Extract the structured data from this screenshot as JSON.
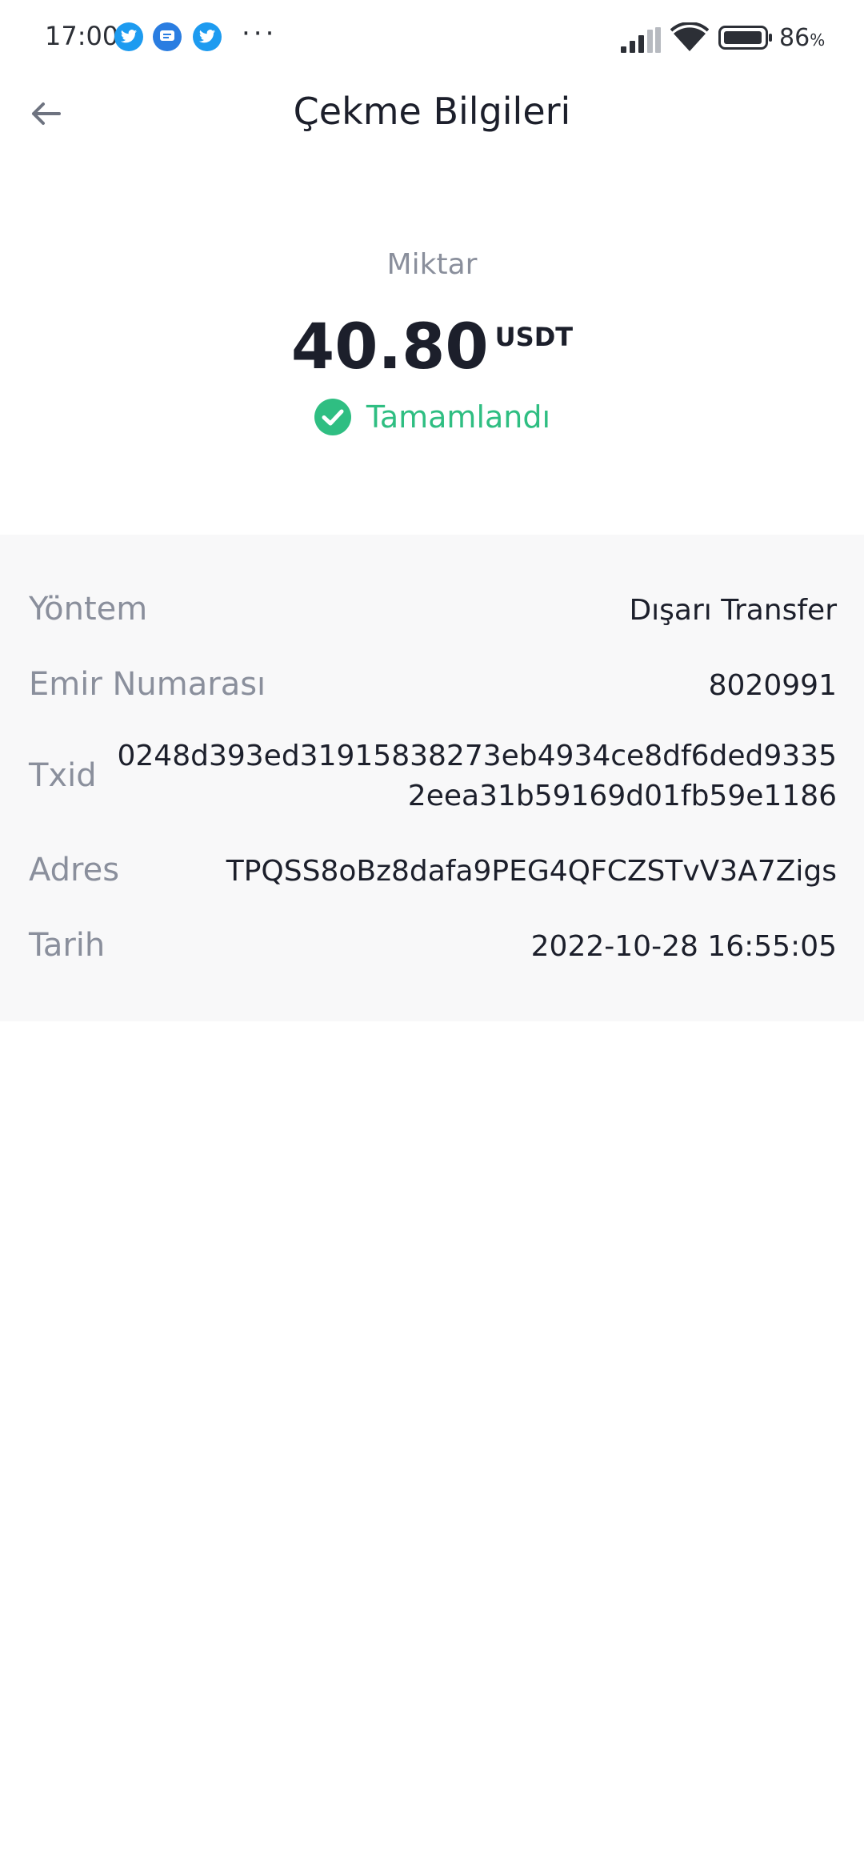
{
  "status_bar": {
    "time": "17:00",
    "notification_icons": [
      "twitter-icon",
      "messages-icon",
      "twitter-icon"
    ],
    "more": "···",
    "battery_percent": "86",
    "battery_unit": "%"
  },
  "header": {
    "title": "Çekme Bilgileri",
    "back_icon": "arrow-left-icon"
  },
  "amount": {
    "label": "Miktar",
    "value": "40.80",
    "unit": "USDT",
    "status": "Tamamlandı",
    "status_icon": "check-circle-icon"
  },
  "details": {
    "rows": [
      {
        "label": "Yöntem",
        "value": "Dışarı Transfer"
      },
      {
        "label": "Emir Numarası",
        "value": "8020991"
      },
      {
        "label": "Txid",
        "value": "0248d393ed31915838273eb4934ce8df6ded93352eea31b59169d01fb59e1186"
      },
      {
        "label": "Adres",
        "value": "TPQSS8oBz8dafa9PEG4QFCZSTvV3A7Zigs"
      },
      {
        "label": "Tarih",
        "value": "2022-10-28 16:55:05"
      }
    ]
  },
  "colors": {
    "success": "#2fbe82",
    "label_gray": "#8a8f9c",
    "text_dark": "#1c1f2b",
    "panel_bg": "#f8f8f9"
  }
}
